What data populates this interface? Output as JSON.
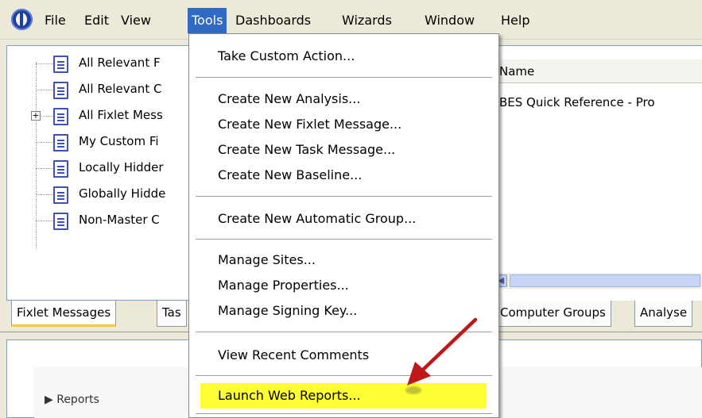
{
  "menubar": {
    "items": [
      "File",
      "Edit",
      "View",
      "Tools",
      "Dashboards",
      "Wizards",
      "Window",
      "Help"
    ],
    "active": "Tools"
  },
  "tree": {
    "items": [
      "All Relevant F",
      "All Relevant C",
      "All Fixlet Mess",
      "My Custom Fi",
      "Locally Hidder",
      "Globally Hidde",
      "Non-Master C"
    ]
  },
  "list": {
    "header": "Name",
    "rows": [
      "BES Quick Reference - Pro"
    ]
  },
  "tabs": [
    "Fixlet Messages",
    "Tas",
    "Computer Groups",
    "Analyse"
  ],
  "tools_menu": {
    "items": [
      "Take Custom Action...",
      "Create New Analysis...",
      "Create New Fixlet Message...",
      "Create New Task Message...",
      "Create New Baseline...",
      "Create New Automatic Group...",
      "Manage Sites...",
      "Manage Properties...",
      "Manage Signing Key...",
      "View Recent Comments",
      "Launch Web Reports..."
    ],
    "highlighted": "Launch Web Reports..."
  },
  "lower": {
    "section": "▶ Reports"
  },
  "colors": {
    "menu_active": "#316ac5",
    "highlight": "#ffff33",
    "arrow": "#cc1f1f",
    "tab_selected_underline": "#ffc83c"
  }
}
